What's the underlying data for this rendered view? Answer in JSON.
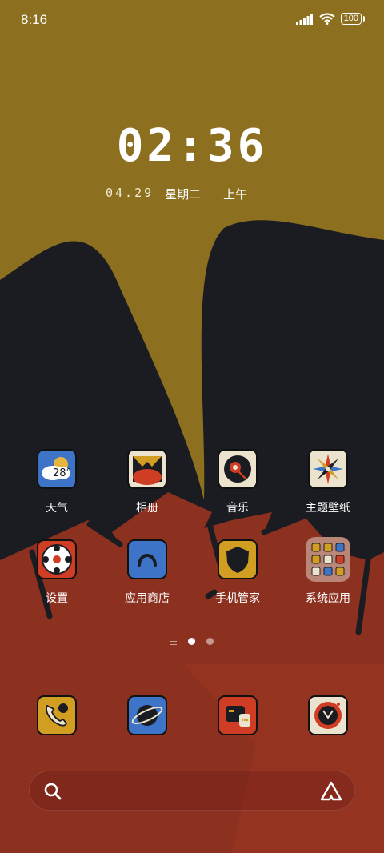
{
  "status_bar": {
    "time": "8:16",
    "battery": "100"
  },
  "lockclock": {
    "time": "02:36",
    "date": "04.29",
    "weekday": "星期二",
    "period": "上午"
  },
  "apps_row1": [
    {
      "label": "天气",
      "icon": "weather-icon",
      "badge": "28°"
    },
    {
      "label": "相册",
      "icon": "gallery-icon"
    },
    {
      "label": "音乐",
      "icon": "music-icon"
    },
    {
      "label": "主题壁纸",
      "icon": "themes-icon"
    }
  ],
  "apps_row2": [
    {
      "label": "设置",
      "icon": "settings-icon"
    },
    {
      "label": "应用商店",
      "icon": "app-store-icon"
    },
    {
      "label": "手机管家",
      "icon": "security-icon"
    },
    {
      "label": "系统应用",
      "icon": "system-apps-folder-icon"
    }
  ],
  "dock": [
    {
      "icon": "phone-icon"
    },
    {
      "icon": "browser-icon"
    },
    {
      "icon": "messages-icon"
    },
    {
      "icon": "camera-icon"
    }
  ],
  "page_indicator": {
    "pages": 2,
    "active": 1
  },
  "colors": {
    "mustard": "#8c6f1f",
    "navy": "#1b1c22",
    "rust": "#8c3020",
    "cream": "#ece3cf",
    "blue": "#3d74c7",
    "red": "#cf3d24",
    "gold": "#d19e22"
  }
}
